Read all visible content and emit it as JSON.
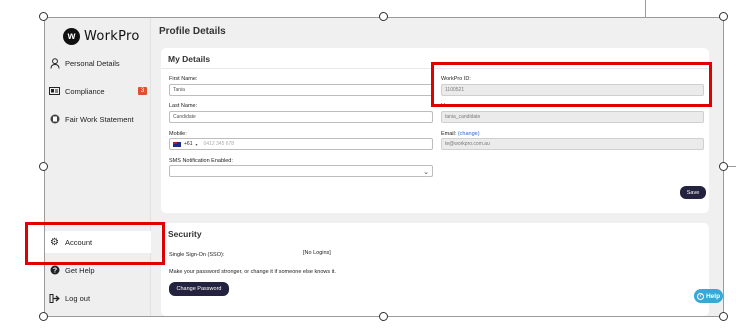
{
  "brand": {
    "logo_mark": "w",
    "name": "WorkPro"
  },
  "sidebar": {
    "items": [
      {
        "label": "Personal Details",
        "icon": "user-icon"
      },
      {
        "label": "Compliance",
        "icon": "id-card-icon",
        "badge": "3"
      },
      {
        "label": "Fair Work Statement",
        "icon": "clipboard-icon"
      },
      {
        "label": "Account",
        "icon": "gear-icon"
      },
      {
        "label": "Get Help",
        "icon": "question-icon"
      },
      {
        "label": "Log out",
        "icon": "logout-icon"
      }
    ]
  },
  "page": {
    "title": "Profile Details"
  },
  "my_details": {
    "title": "My Details",
    "first_name": {
      "label": "First Name:",
      "value": "Tania"
    },
    "workpro_id": {
      "label": "WorkPro ID:",
      "value": "1100521"
    },
    "last_name": {
      "label": "Last Name:",
      "value": "Candidate"
    },
    "username": {
      "label": "User name:",
      "value": "tania_candidate"
    },
    "mobile": {
      "label": "Mobile:",
      "country_code": "+61",
      "placeholder": "0412 345 678"
    },
    "email": {
      "label": "Email:",
      "change_link": "(change)",
      "value": "te@workpro.com.au"
    },
    "sms": {
      "label": "SMS Notification Enabled:",
      "value": ""
    },
    "save_label": "Save"
  },
  "security": {
    "title": "Security",
    "sso_label": "Single Sign-On (SSO):",
    "sso_value": "[No Logins]",
    "password_hint": "Make your password stronger, or change it if someone else knows it.",
    "change_password_label": "Change Password"
  },
  "help_button": {
    "label": "Help"
  },
  "colors": {
    "annotation": "#e00000",
    "primary": "#24233f",
    "badge": "#e0522f",
    "help": "#39a7d8"
  }
}
